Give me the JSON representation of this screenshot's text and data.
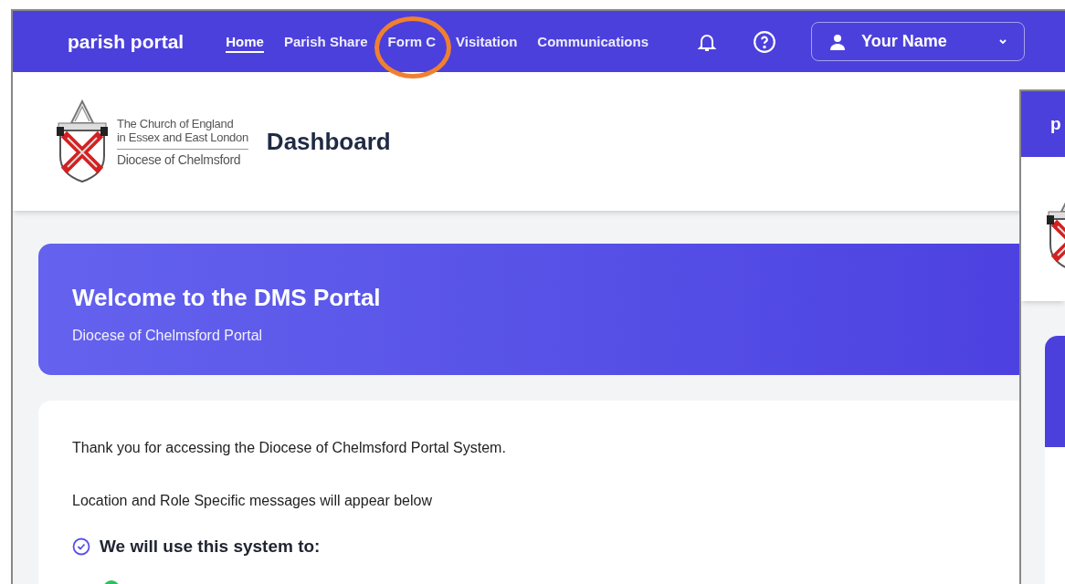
{
  "nav": {
    "brand": "parish portal",
    "links": [
      {
        "label": "Home",
        "selected": true,
        "circled": false
      },
      {
        "label": "Parish Share",
        "selected": false,
        "circled": false
      },
      {
        "label": "Form C",
        "selected": false,
        "circled": true
      },
      {
        "label": "Visitation",
        "selected": false,
        "circled": false
      },
      {
        "label": "Communications",
        "selected": false,
        "circled": false
      }
    ],
    "user": "Your Name"
  },
  "header": {
    "logo_lines": [
      "The Church of England",
      "in Essex and East London",
      "Diocese of Chelmsford"
    ],
    "title": "Dashboard"
  },
  "banner": {
    "title": "Welcome to the DMS Portal",
    "subtitle": "Diocese of Chelmsford Portal"
  },
  "card": {
    "paragraphs": [
      "Thank you for accessing the Diocese of Chelmsford Portal System.",
      "Location and Role Specific messages will appear below"
    ],
    "heading": "We will use this system to:"
  },
  "second_window": {
    "brand": "p"
  }
}
